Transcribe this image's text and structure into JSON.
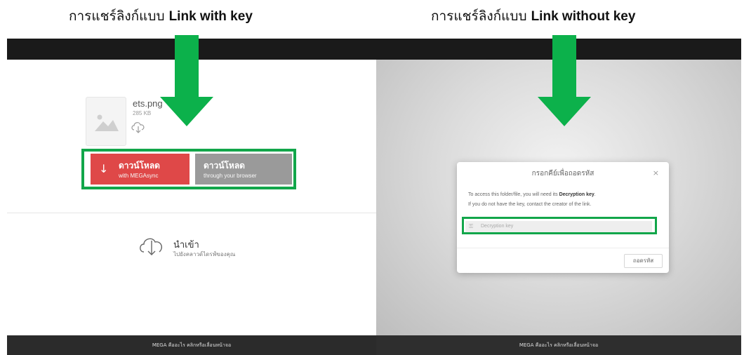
{
  "captions": {
    "left_prefix": "การแชร์ลิงก์แบบ",
    "left_bold": "Link with key",
    "right_prefix": "การแชร์ลิงก์แบบ",
    "right_bold": "Link without key"
  },
  "left_panel": {
    "file_name": "ets.png",
    "file_size": "285 KB",
    "download_megasync": {
      "title": "ดาวน์โหลด",
      "subtitle": "with MEGAsync"
    },
    "download_browser": {
      "title": "ดาวน์โหลด",
      "subtitle": "through your browser"
    },
    "import": {
      "title": "นำเข้า",
      "subtitle": "ไปยังคลาวด์ไดรฟ์ของคุณ"
    },
    "footer": "MEGA คืออะไร คลิกหรือเลื่อนหน้าจอ"
  },
  "right_panel": {
    "dialog": {
      "title": "กรอกคีย์เพื่อถอดรหัส",
      "close": "×",
      "line1_prefix": "To access this folder/file, you will need its ",
      "line1_bold": "Decryption key",
      "line1_suffix": ".",
      "line2": "If you do not have the key, contact the creator of the link.",
      "input_placeholder": "Decryption key",
      "decrypt_button": "ถอดรหัส"
    },
    "footer": "MEGA คืออะไร คลิกหรือเลื่อนหน้าจอ"
  },
  "colors": {
    "highlight_green": "#12a64a",
    "mega_red": "#df4848",
    "arrow_green": "#0cb14b"
  }
}
